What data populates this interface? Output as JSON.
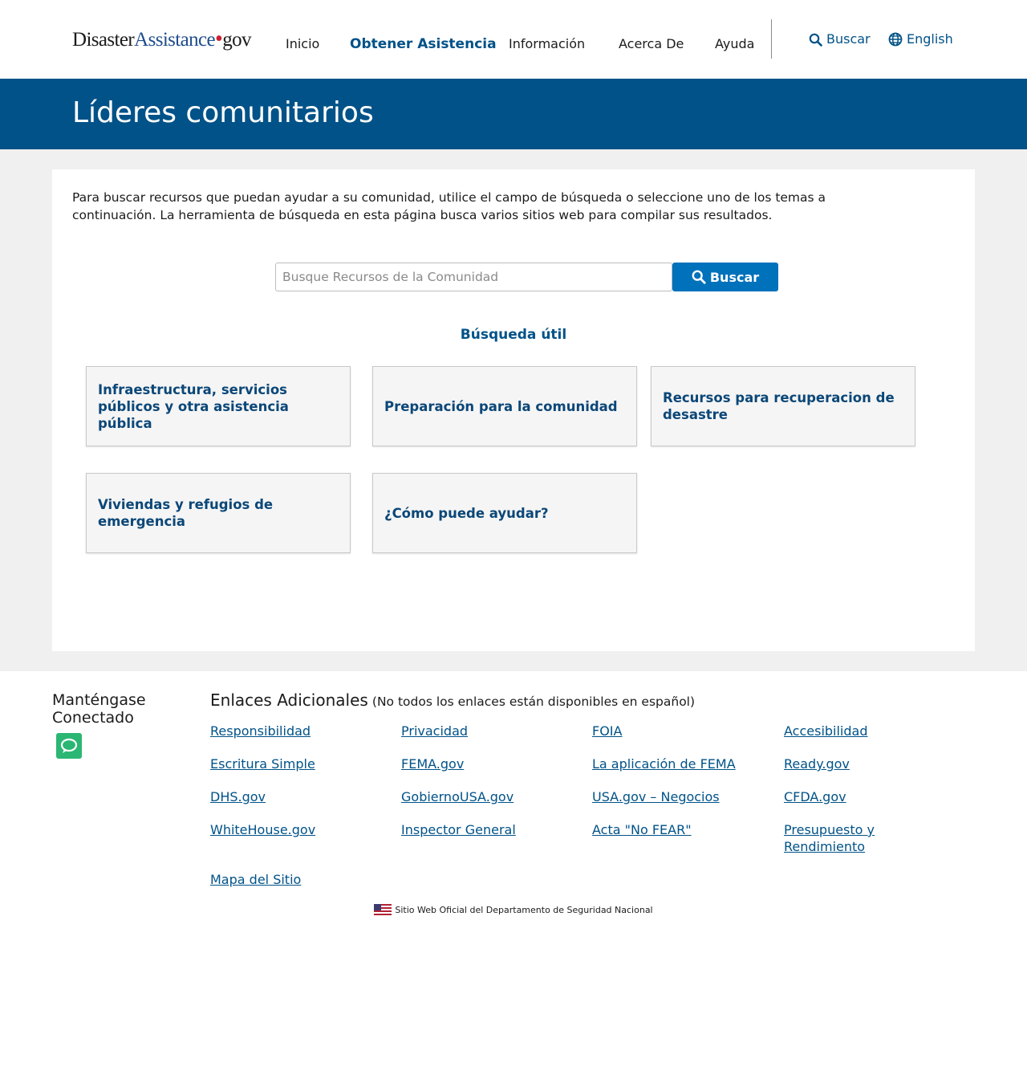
{
  "header": {
    "logo": {
      "part1": "Disaster",
      "part2": "Assistance",
      "dot": "•",
      "part3": "gov"
    },
    "nav": [
      {
        "label": "Inicio"
      },
      {
        "label": "Obtener Asistencia",
        "active": true
      },
      {
        "label": "Información"
      },
      {
        "label": "Acerca De"
      },
      {
        "label": "Ayuda"
      }
    ],
    "search_label": "Buscar",
    "language_label": "English"
  },
  "banner": {
    "title": "Líderes comunitarios"
  },
  "main": {
    "intro": "Para buscar recursos que puedan ayudar a su comunidad, utilice el campo de búsqueda o seleccione uno de los temas a continuación. La herramienta de búsqueda en esta página busca varios sitios web para compilar sus resultados.",
    "search": {
      "placeholder": "Busque Recursos de la Comunidad",
      "value": "",
      "button_label": "Buscar"
    },
    "helpful_title": "Búsqueda útil",
    "topics": [
      {
        "label": "Infraestructura, servicios públicos y otra asistencia pública"
      },
      {
        "label": "Preparación para la comunidad"
      },
      {
        "label": "Recursos para recuperacion de desastre"
      },
      {
        "label": "Viviendas y refugios de emergencia"
      },
      {
        "label": "¿Cómo puede ayudar?"
      }
    ]
  },
  "footer": {
    "stay_connected": "Manténgase Conectado",
    "links_title": "Enlaces Adicionales",
    "links_note": "(No todos los enlaces están disponibles en español)",
    "links": [
      "Responsibilidad",
      "Privacidad",
      "FOIA",
      "Accesibilidad",
      "Escritura Simple",
      "FEMA.gov",
      "La aplicación de FEMA",
      "Ready.gov",
      "DHS.gov",
      "GobiernoUSA.gov",
      "USA.gov – Negocios",
      "CFDA.gov",
      "WhiteHouse.gov",
      "Inspector General",
      "Acta \"No FEAR\"",
      "Presupuesto y Rendimiento",
      "Mapa del Sitio"
    ],
    "official": "Sitio Web Oficial del Departamento de Seguridad Nacional"
  },
  "colors": {
    "primary": "#005288",
    "button": "#0071bb",
    "chat_icon": "#2bb673",
    "logo_dot": "#cc1f2f"
  },
  "icons": [
    "search-icon",
    "globe-icon",
    "chat-bubble-icon",
    "us-flag-icon"
  ]
}
